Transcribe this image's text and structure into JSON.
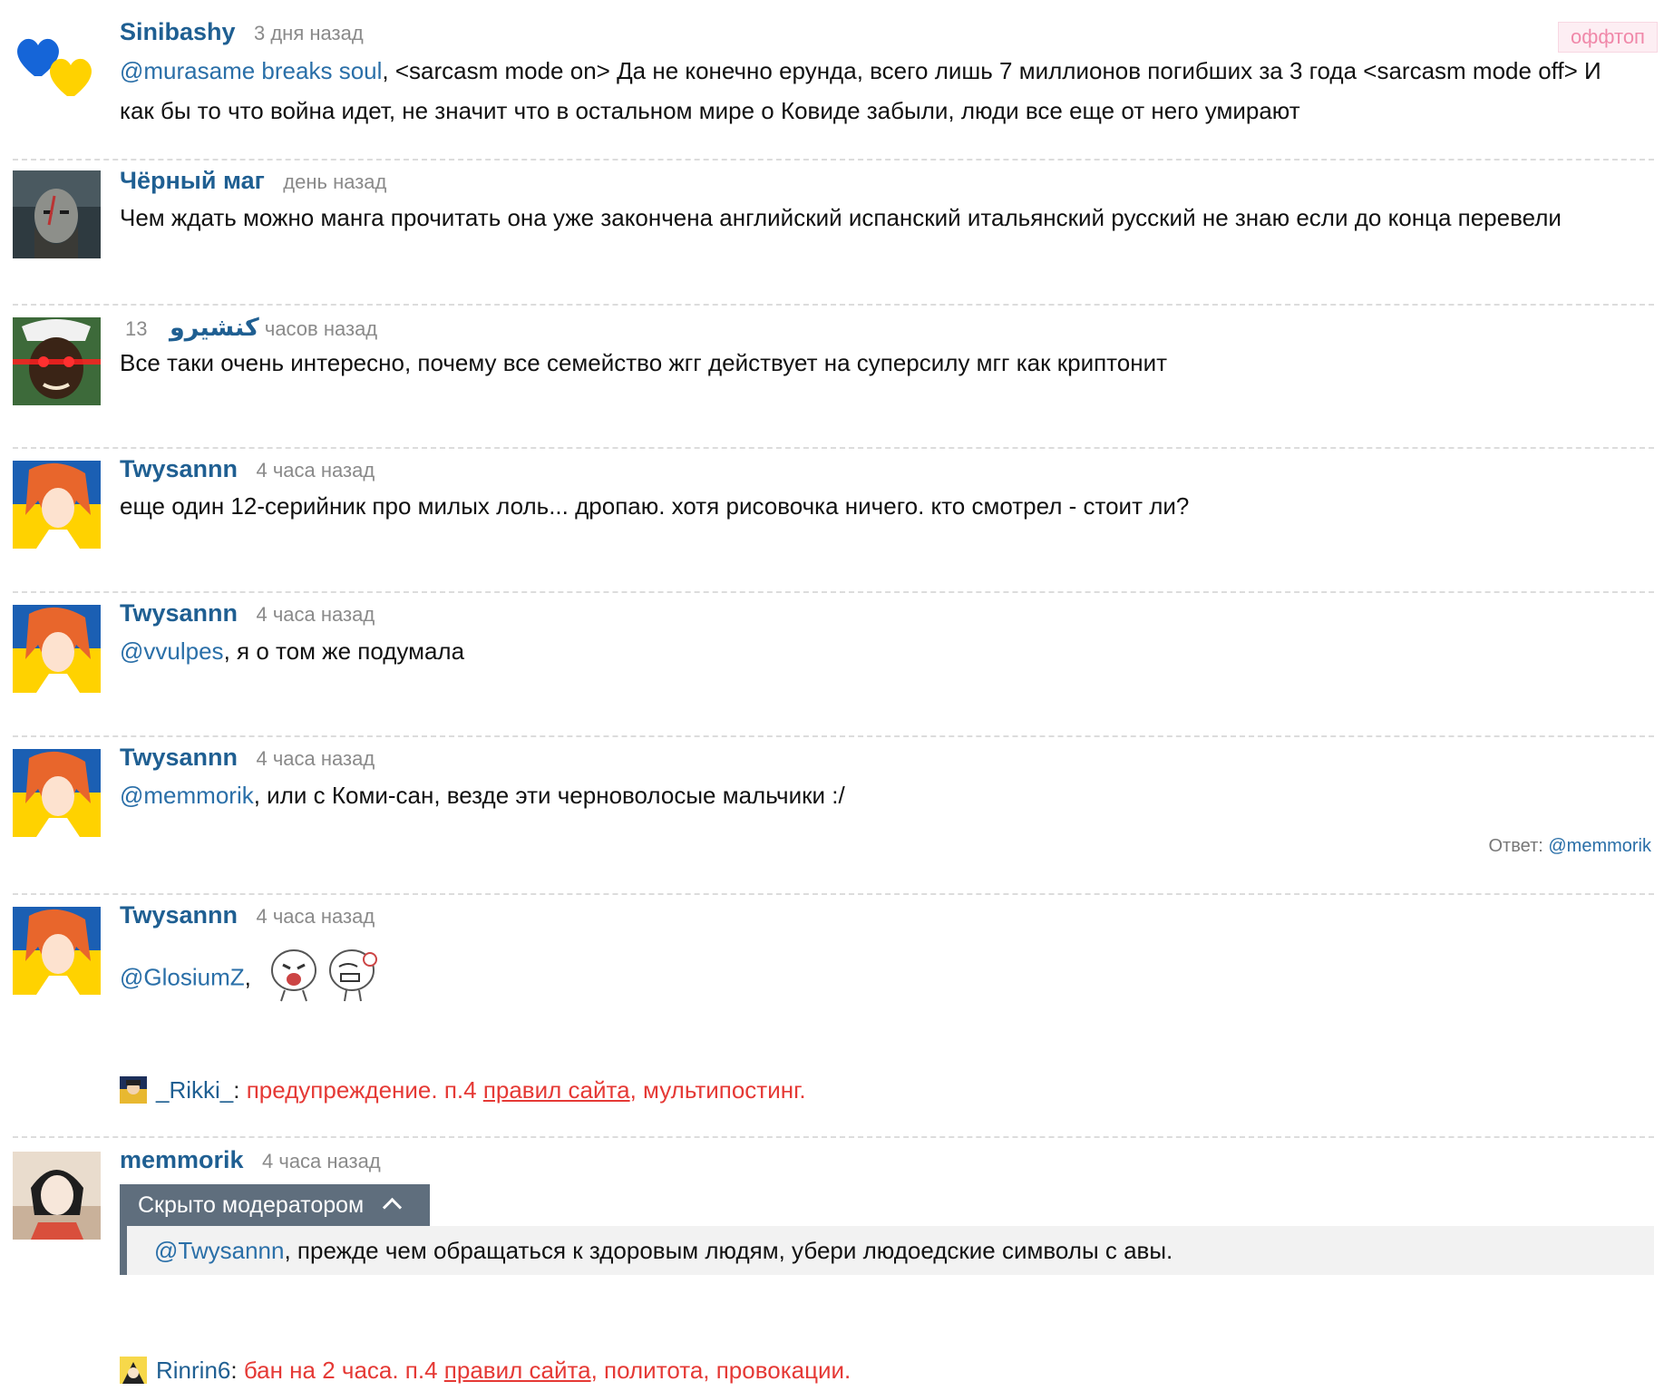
{
  "labels": {
    "reply_prefix": "Ответ:"
  },
  "comments": [
    {
      "username": "Sinibashy",
      "time": "3 дня назад",
      "badge": "оффтоп",
      "mention": "@murasame breaks soul",
      "text_line1": ", <sarcasm mode on> Да не конечно ерунда, всего лишь 7 миллионов погибших за 3 года <sarcasm mode off> И",
      "text_line2": "как бы то что война идет, не значит что в остальном мире о Ковиде забыли, люди все еще от него умирают"
    },
    {
      "username": "Чёрный маг",
      "time": "день назад",
      "text": "Чем ждать можно манга прочитать она уже закончена английский испанский итальянский русский не знаю если до конца перевели"
    },
    {
      "username": "كنشيرو",
      "time": "13 часов назад",
      "text": "Все таки очень интересно, почему все семейство жгг действует на суперсилу мгг как криптонит"
    },
    {
      "username": "Twysannn",
      "time": "4 часа назад",
      "text": "еще один 12-серийник про милых лоль... дропаю. хотя рисовочка ничего. кто смотрел - стоит ли?"
    },
    {
      "username": "Twysannn",
      "time": "4 часа назад",
      "mention": "@vvulpes",
      "text": ", я о том же подумала"
    },
    {
      "username": "Twysannn",
      "time": "4 часа назад",
      "mention": "@memmorik",
      "text": ", или с Коми-сан, везде эти черноволосые мальчики :/",
      "reply_to": "@memmorik"
    },
    {
      "username": "Twysannn",
      "time": "4 часа назад",
      "mention": "@GlosiumZ",
      "text": ",",
      "moderation": {
        "moderator": "_Rikki_",
        "colon": ":",
        "before": " предупреждение. п.4 ",
        "link": "правил сайта",
        "after": ", мультипостинг."
      }
    },
    {
      "username": "memmorik",
      "time": "4 часа назад",
      "hidden_label": "Скрыто модератором",
      "mention": "@Twysannn",
      "text": ", прежде чем обращаться к здоровым людям, убери людоедские символы с авы.",
      "moderation": {
        "moderator": "Rinrin6",
        "colon": ":",
        "before": " бан на 2 часа. п.4 ",
        "link": "правил сайта",
        "after": ", политота, провокации."
      }
    }
  ],
  "colors": {
    "username": "#1f5f92",
    "mention": "#2a6fa8",
    "moderation_red": "#e53935",
    "hidden_bar": "#5f6e7d",
    "badge_text": "#f088a9"
  },
  "icons": [
    "heart-avatar",
    "warrior-avatar",
    "red-eyes-avatar",
    "anime-girl-avatar",
    "girl-portrait-avatar",
    "moderator-mini-avatar",
    "smiley-sticker",
    "chevron-up-icon"
  ]
}
